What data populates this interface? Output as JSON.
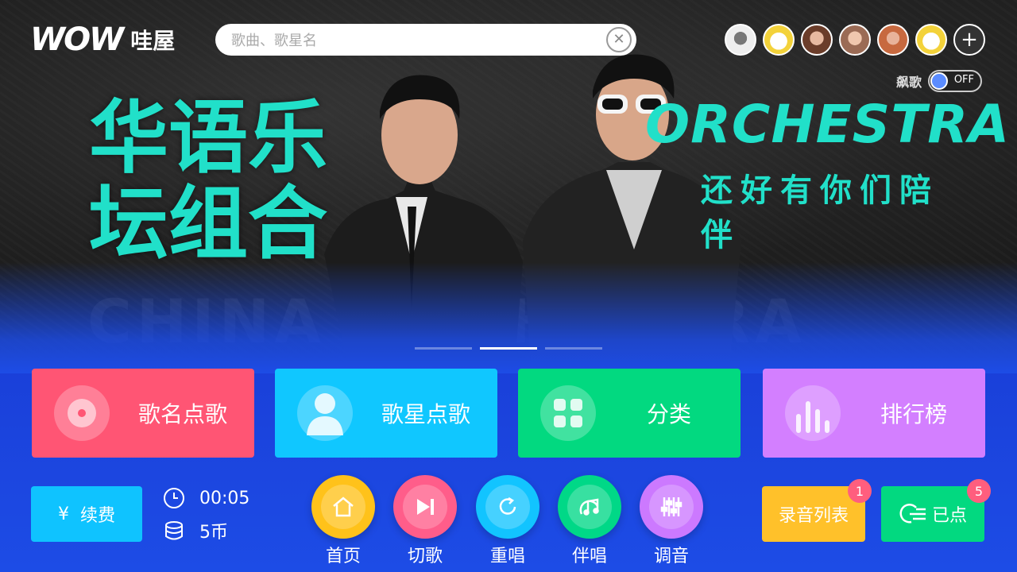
{
  "logo": {
    "brand": "WOW",
    "name": "哇屋"
  },
  "search": {
    "placeholder": "歌曲、歌星名"
  },
  "piaoge": {
    "label": "飙歌",
    "state": "OFF"
  },
  "banner": {
    "headline": "华语乐坛组合",
    "english": "ORCHESTRA",
    "tagline": "还好有你们陪伴",
    "ghost": "CHINA ORCHESTRA"
  },
  "carousel": {
    "count": 3,
    "active_index": 1
  },
  "cards": [
    {
      "label": "歌名点歌",
      "icon": "disc-icon",
      "color": "#ff5574"
    },
    {
      "label": "歌星点歌",
      "icon": "singer-icon",
      "color": "#10c7ff"
    },
    {
      "label": "分类",
      "icon": "grid-icon",
      "color": "#02d980"
    },
    {
      "label": "排行榜",
      "icon": "chart-bars-icon",
      "color": "#d37fff"
    }
  ],
  "account": {
    "renew_label": "续费",
    "renew_icon": "yuan-icon",
    "time": "00:05",
    "coins": "5币"
  },
  "controls": [
    {
      "label": "首页",
      "icon": "home-icon",
      "color": "#ffc21a"
    },
    {
      "label": "切歌",
      "icon": "skip-icon",
      "color": "#ff5d8a"
    },
    {
      "label": "重唱",
      "icon": "replay-icon",
      "color": "#12c4ff"
    },
    {
      "label": "伴唱",
      "icon": "music-note-icon",
      "color": "#00d887"
    },
    {
      "label": "调音",
      "icon": "equalizer-icon",
      "color": "#cc79ff"
    }
  ],
  "record_list": {
    "label": "录音列表",
    "badge": "1"
  },
  "picked": {
    "label": "已点",
    "badge": "5"
  }
}
